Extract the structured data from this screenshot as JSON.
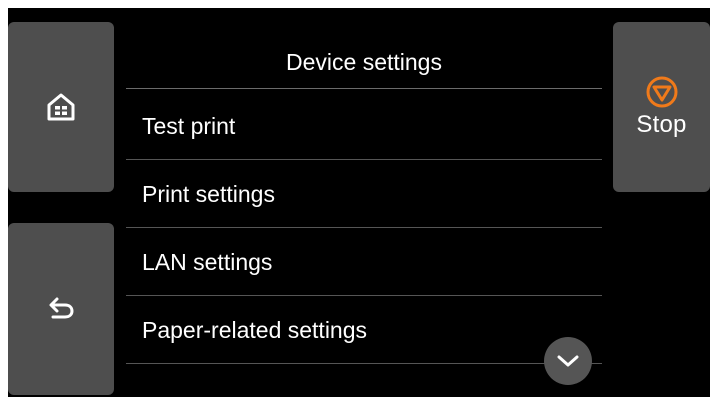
{
  "screen": {
    "title": "Device settings"
  },
  "nav": {
    "home_icon": "home-icon",
    "back_icon": "back-arrow-icon"
  },
  "stop": {
    "label": "Stop",
    "icon": "stop-icon",
    "icon_color": "#f07a1a"
  },
  "menu": {
    "items": [
      {
        "label": "Test print"
      },
      {
        "label": "Print settings"
      },
      {
        "label": "LAN settings"
      },
      {
        "label": "Paper-related settings"
      }
    ]
  },
  "scroll": {
    "icon": "chevron-down-icon"
  },
  "colors": {
    "background": "#000000",
    "button": "#4e4e4e",
    "text": "#ffffff"
  }
}
